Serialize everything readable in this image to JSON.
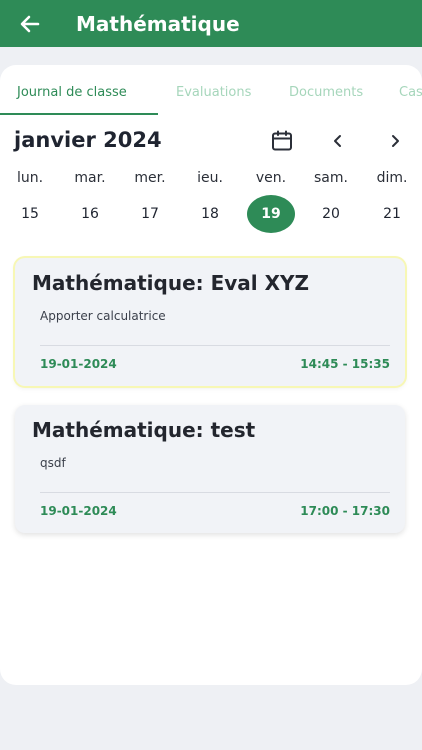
{
  "header": {
    "title": "Mathématique",
    "back_icon": "arrow-left-icon"
  },
  "tabs": [
    {
      "label": "Journal de classe",
      "active": true
    },
    {
      "label": "Evaluations",
      "active": false
    },
    {
      "label": "Documents",
      "active": false
    },
    {
      "label": "Cas",
      "active": false
    }
  ],
  "calendar": {
    "month_label": "janvier 2024",
    "days": [
      {
        "name": "lun.",
        "number": "15"
      },
      {
        "name": "mar.",
        "number": "16"
      },
      {
        "name": "mer.",
        "number": "17"
      },
      {
        "name": "ieu.",
        "number": "18"
      },
      {
        "name": "ven.",
        "number": "19",
        "selected": true
      },
      {
        "name": "sam.",
        "number": "20"
      },
      {
        "name": "dim.",
        "number": "21"
      }
    ]
  },
  "entries": [
    {
      "title": "Mathématique: Eval XYZ",
      "description": "Apporter calculatrice",
      "date": "19-01-2024",
      "time": "14:45 - 15:35"
    },
    {
      "title": "Mathématique: test",
      "description": "qsdf",
      "date": "19-01-2024",
      "time": "17:00 - 17:30"
    }
  ],
  "colors": {
    "primary": "#2e8b57",
    "background": "#eef0f4",
    "card": "#f1f3f7",
    "highlight": "#f7f7b5"
  }
}
